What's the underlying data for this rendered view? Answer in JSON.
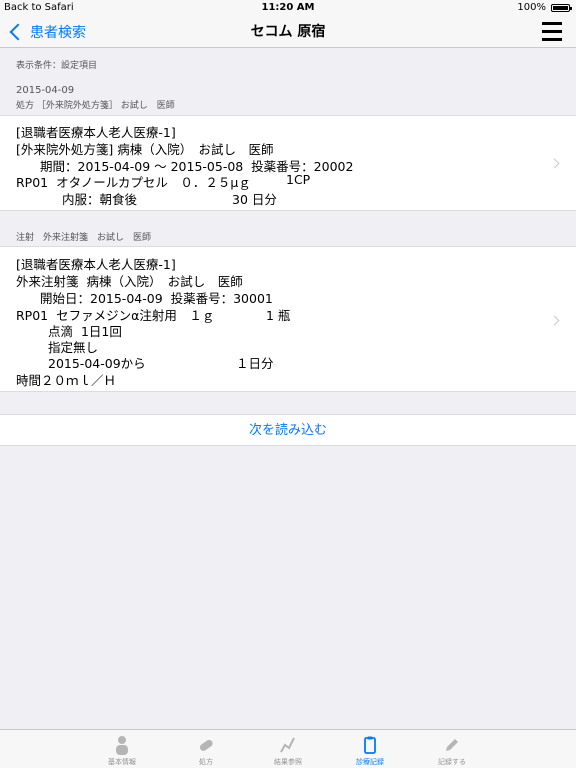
{
  "status": {
    "back": "Back to Safari",
    "time": "11:20 AM",
    "battery": "100%"
  },
  "nav": {
    "back_label": "患者検索",
    "title": "セコム 原宿"
  },
  "filter": {
    "label": "表示条件：設定項目"
  },
  "groups": [
    {
      "date": "2015-04-09",
      "subheader": "処方 ［外来院外処方箋］ お試し　医師",
      "lines": [
        "[退職者医療本人老人医療-1]",
        "[外来院外処方箋] 病棟（入院）　お試し　医師",
        "期間：2015-04-09 ～ 2015-05-08  投薬番号：20002",
        "RP01  オタノールカプセル　０．２５μｇ",
        "1CP",
        "内服：朝食後",
        "30 日分"
      ]
    },
    {
      "subheader": "注射　外来注射箋　お試し　医師",
      "lines": [
        "[退職者医療本人老人医療-1]",
        "外来注射箋  病棟（入院）　お試し　医師",
        "開始日：2015-04-09  投薬番号：30001",
        "RP01  セファメジンα注射用　１ｇ",
        "1 瓶",
        "点滴  1日1回",
        "指定無し",
        "2015-04-09から",
        "１日分",
        "時間２０ｍｌ／Ｈ"
      ]
    }
  ],
  "load_more": "次を読み込む",
  "tabs": [
    {
      "label": "基本情報",
      "icon": "person-icon"
    },
    {
      "label": "処方",
      "icon": "pill-icon"
    },
    {
      "label": "結果参照",
      "icon": "chart-icon"
    },
    {
      "label": "診療記録",
      "icon": "clipboard-icon",
      "active": true
    },
    {
      "label": "記録する",
      "icon": "pencil-icon"
    }
  ],
  "colors": {
    "accent": "#007aff",
    "inactive": "#929292",
    "background": "#efeff4"
  }
}
